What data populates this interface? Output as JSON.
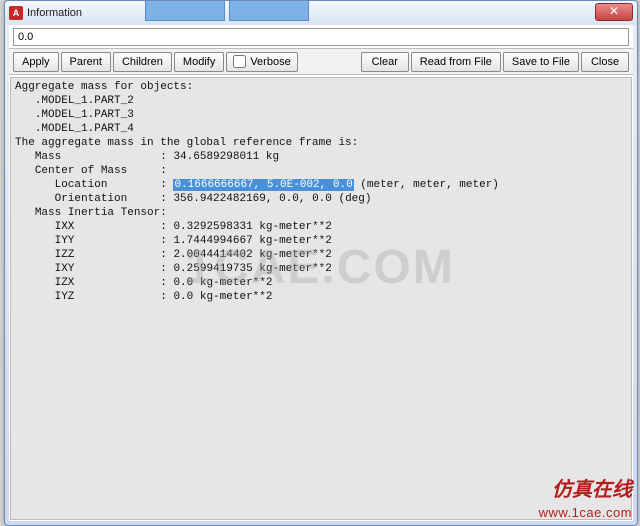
{
  "window": {
    "app_icon_letter": "A",
    "title": "Information"
  },
  "bg_tabs": [
    "",
    ""
  ],
  "cmd": {
    "value": "0.0"
  },
  "toolbar": {
    "apply": "Apply",
    "parent": "Parent",
    "children": "Children",
    "modify": "Modify",
    "verbose": "Verbose",
    "clear": "Clear",
    "read": "Read from File",
    "save": "Save to File",
    "close": "Close"
  },
  "output": {
    "header": "Aggregate mass for objects:",
    "objects": [
      ".MODEL_1.PART_2",
      ".MODEL_1.PART_3",
      ".MODEL_1.PART_4"
    ],
    "agg_line": "The aggregate mass in the global reference frame is:",
    "mass": {
      "label": "Mass",
      "value": "34.6589298011 kg"
    },
    "com_header": "Center of Mass",
    "location": {
      "label": "Location",
      "value": "0.1666666667, 5.0E-002, 0.0",
      "units": "(meter, meter, meter)"
    },
    "orientation": {
      "label": "Orientation",
      "value": "356.9422482169, 0.0, 0.0 (deg)"
    },
    "inertia_header": "Mass Inertia Tensor",
    "ixx": {
      "label": "IXX",
      "value": "0.3292598331 kg-meter**2"
    },
    "iyy": {
      "label": "IYY",
      "value": "1.7444994667 kg-meter**2"
    },
    "izz": {
      "label": "IZZ",
      "value": "2.0044414402 kg-meter**2"
    },
    "ixy": {
      "label": "IXY",
      "value": "0.2599419735 kg-meter**2"
    },
    "izx": {
      "label": "IZX",
      "value": "0.0 kg-meter**2"
    },
    "iyz": {
      "label": "IYZ",
      "value": "0.0 kg-meter**2"
    }
  },
  "watermark": "1CAE.COM",
  "footer": {
    "cn": "仿真在线",
    "url": "www.1cae.com"
  }
}
